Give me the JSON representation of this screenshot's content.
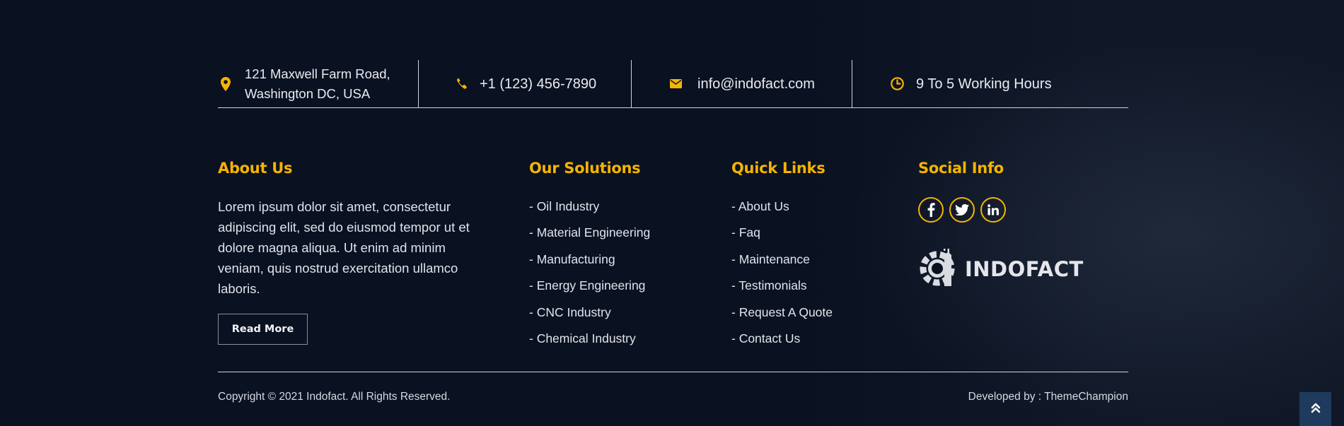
{
  "contact": {
    "address_line1": "121 Maxwell Farm Road,",
    "address_line2": "Washington DC, USA",
    "phone": "+1 (123) 456-7890",
    "email": "info@indofact.com",
    "hours": "9 To 5 Working Hours",
    "icons": [
      "map-marker-icon",
      "phone-icon",
      "envelope-icon",
      "clock-icon"
    ]
  },
  "about": {
    "title": "About Us",
    "text": "Lorem ipsum dolor sit amet, consectetur adipiscing elit, sed do eiusmod tempor ut et dolore magna aliqua. Ut enim ad minim veniam, quis nostrud exercitation ullamco laboris.",
    "read_more": "Read More"
  },
  "solutions": {
    "title": "Our Solutions",
    "items": [
      "- Oil Industry",
      "- Material Engineering",
      "- Manufacturing",
      "- Energy Engineering",
      "- CNC Industry",
      "- Chemical Industry"
    ]
  },
  "quick_links": {
    "title": "Quick Links",
    "items": [
      "- About Us",
      "- Faq",
      "- Maintenance",
      "- Testimonials",
      "- Request A Quote",
      "- Contact Us"
    ]
  },
  "social": {
    "title": "Social Info",
    "icons": [
      "facebook-icon",
      "twitter-icon",
      "linkedin-icon"
    ]
  },
  "logo": {
    "text": "INDOFACT"
  },
  "footer": {
    "copyright": "Copyright © 2021 Indofact. All Rights Reserved.",
    "developed": "Developed by : ThemeChampion"
  },
  "colors": {
    "accent": "#f5b400",
    "background": "#0a1121",
    "to_top_bg": "#1e3a5c"
  }
}
